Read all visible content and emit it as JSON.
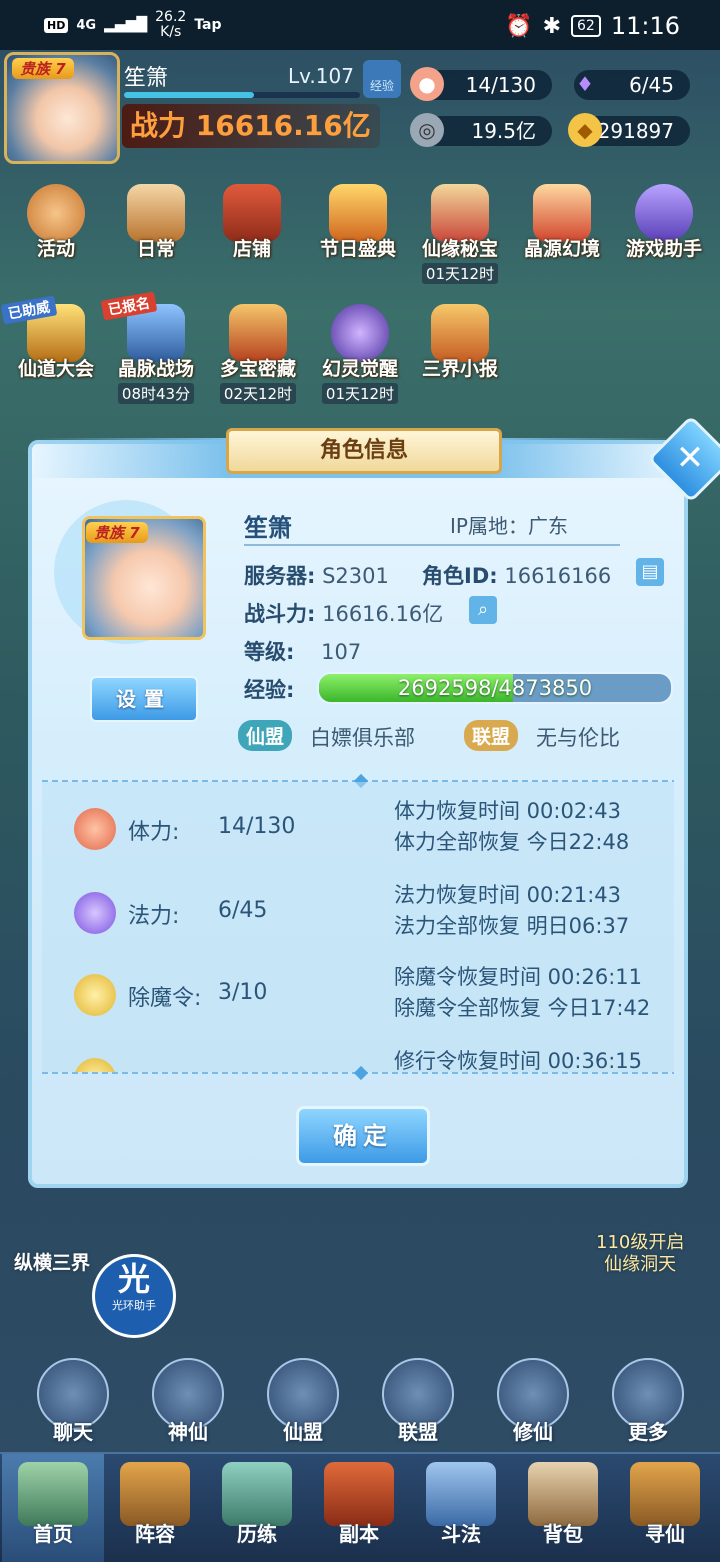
{
  "status_bar": {
    "hd": "HD",
    "signal": "4G",
    "speed": "26.2",
    "speed_unit": "K/s",
    "app": "Tap",
    "battery": "62",
    "time": "11:16"
  },
  "hud": {
    "vip": "贵族 7",
    "name": "笙箫",
    "level": "Lv.107",
    "exp_button": "经验",
    "exp_progress": 0.55,
    "power": "战力 16616.16亿",
    "stamina": "14/130",
    "mana": "6/45",
    "coins": "19.5亿",
    "gold": "291897"
  },
  "menu_row1": [
    {
      "label": "活动",
      "timer": ""
    },
    {
      "label": "日常",
      "timer": ""
    },
    {
      "label": "店铺",
      "timer": ""
    },
    {
      "label": "节日盛典",
      "timer": ""
    },
    {
      "label": "仙缘秘宝",
      "timer": "01天12时"
    },
    {
      "label": "晶源幻境",
      "timer": ""
    },
    {
      "label": "游戏助手",
      "timer": ""
    }
  ],
  "menu_row2": [
    {
      "label": "仙道大会",
      "timer": "",
      "tag": "已助威"
    },
    {
      "label": "晶脉战场",
      "timer": "08时43分",
      "tag": "已报名"
    },
    {
      "label": "多宝密藏",
      "timer": "02天12时"
    },
    {
      "label": "幻灵觉醒",
      "timer": "01天12时"
    },
    {
      "label": "三界小报",
      "timer": ""
    }
  ],
  "dialog": {
    "title": "角色信息",
    "vip": "贵族 7",
    "settings_button": "设置",
    "name": "笙箫",
    "ip": "IP属地：广东",
    "server_label": "服务器:",
    "server": "S2301",
    "role_id_label": "角色ID:",
    "role_id": "16616166",
    "power_label": "战斗力:",
    "power": "16616.16亿",
    "level_label": "等级:",
    "level": "107",
    "exp_label": "经验:",
    "exp_text": "2692598/4873850",
    "exp_progress": 0.5525,
    "guild_chip": "仙盟",
    "guild_name": "白嫖俱乐部",
    "alliance_chip": "联盟",
    "alliance_name": "无与伦比",
    "stats": [
      {
        "label": "体力:",
        "value": "14/130",
        "line1": "体力恢复时间 00:02:43",
        "line2": "体力全部恢复 今日22:48"
      },
      {
        "label": "法力:",
        "value": "6/45",
        "line1": "法力恢复时间 00:21:43",
        "line2": "法力全部恢复 明日06:37"
      },
      {
        "label": "除魔令:",
        "value": "3/10",
        "line1": "除魔令恢复时间 00:26:11",
        "line2": "除魔令全部恢复 今日17:42"
      },
      {
        "label": "",
        "value": "",
        "line1": "修行令恢复时间 00:36:15",
        "line2": ""
      }
    ],
    "ok_button": "确定"
  },
  "side": {
    "left_label": "纵横三界",
    "halo_glyph": "光",
    "halo_label": "光环助手",
    "unlock_line1": "110级开启",
    "unlock_line2": "仙缘洞天"
  },
  "mid_icons": [
    "聊天",
    "神仙",
    "仙盟",
    "联盟",
    "修仙",
    "更多"
  ],
  "nav": [
    "首页",
    "阵容",
    "历练",
    "副本",
    "斗法",
    "背包",
    "寻仙"
  ],
  "colors": {
    "accent": "#3d9ae6",
    "exp_fill": "#3bb62b",
    "power": "#ff9e3d"
  }
}
